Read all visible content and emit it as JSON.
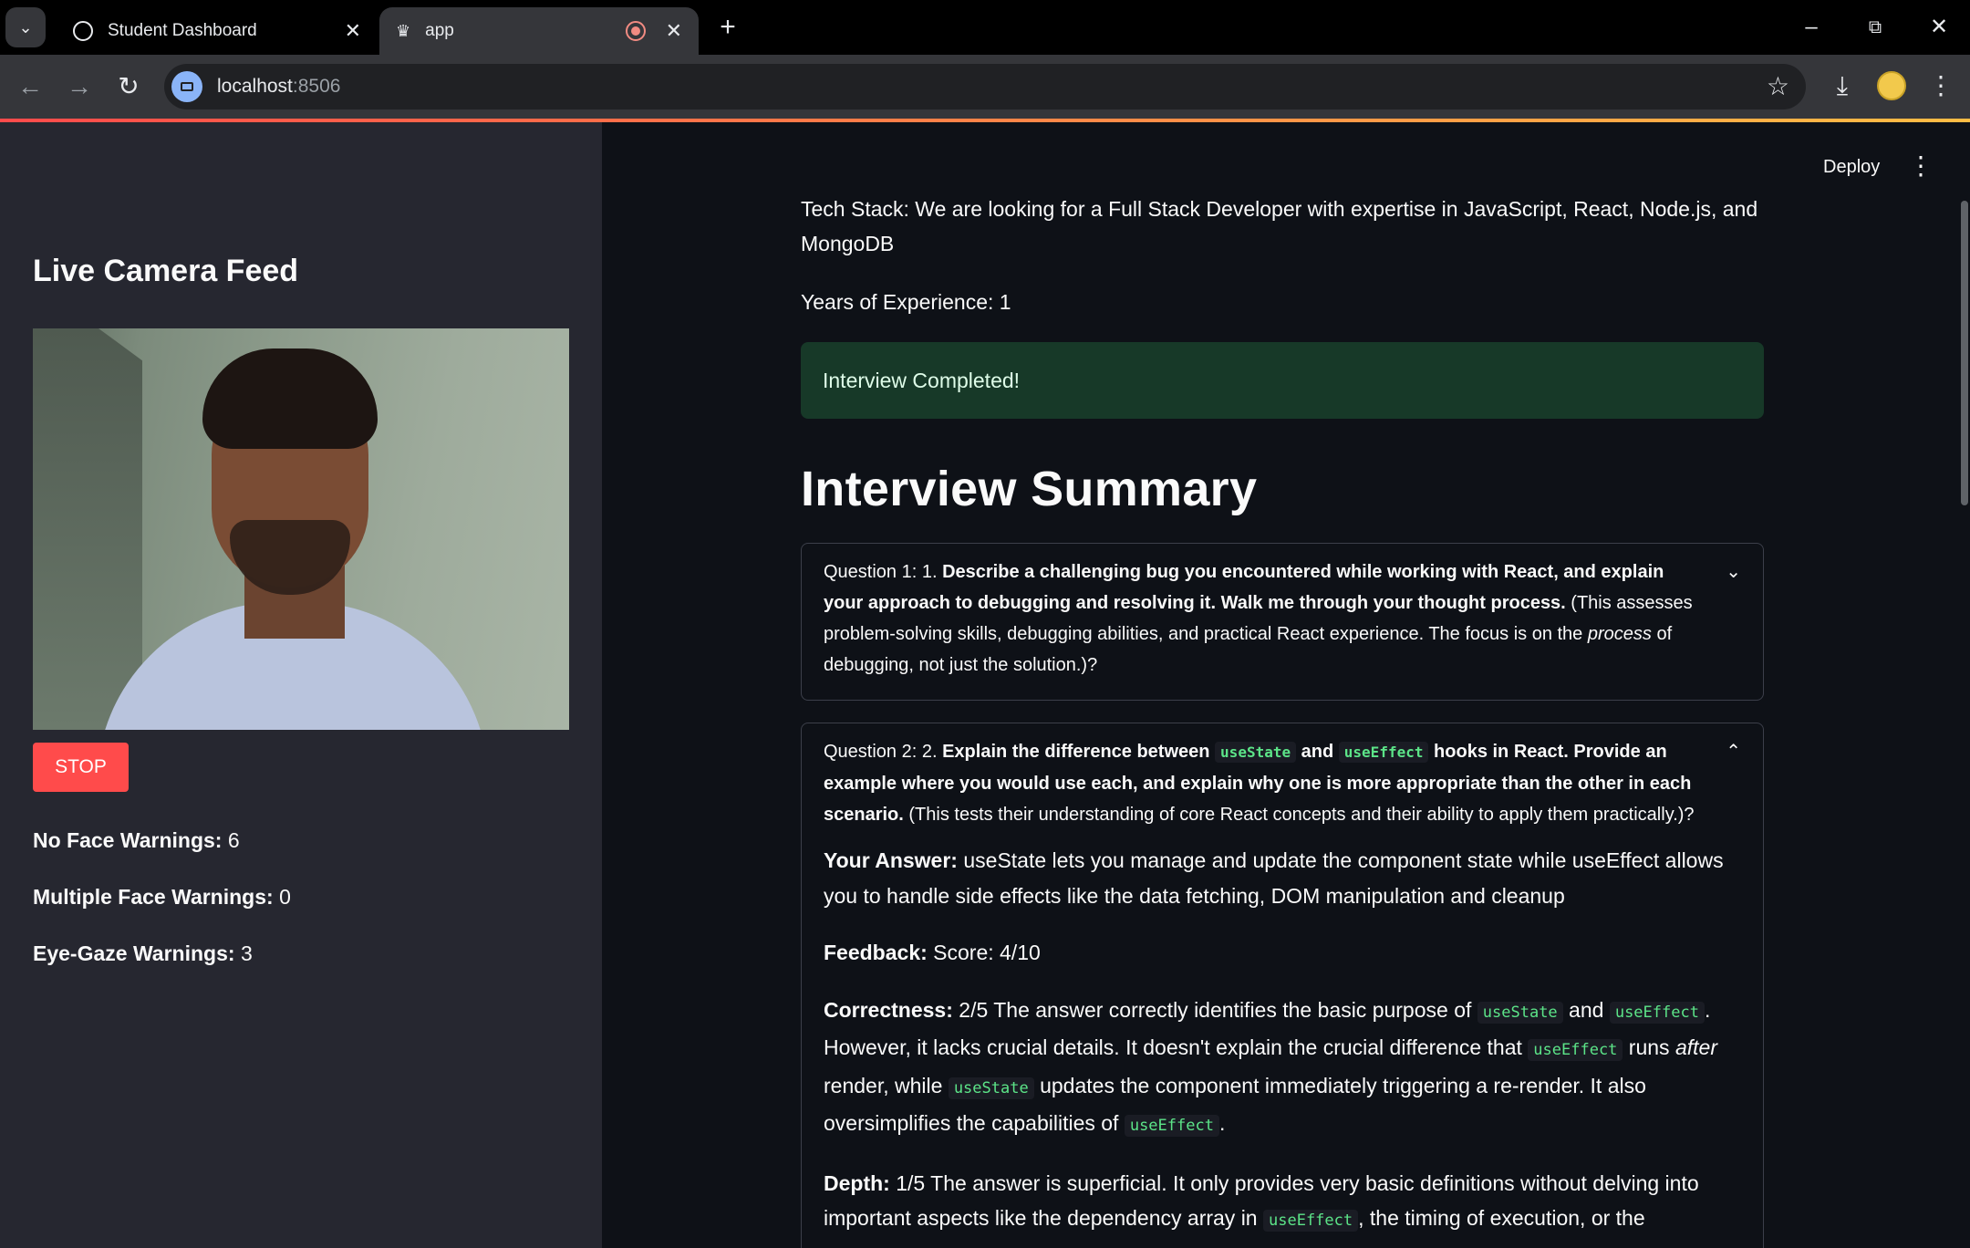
{
  "browser": {
    "tabs": [
      {
        "title": "Student Dashboard"
      },
      {
        "title": "app"
      }
    ],
    "url_host": "localhost",
    "url_port": ":8506"
  },
  "sidebar": {
    "title": "Live Camera Feed",
    "stop_label": "STOP",
    "warnings": [
      {
        "label": "No Face Warnings:",
        "value": "6"
      },
      {
        "label": "Multiple Face Warnings:",
        "value": "0"
      },
      {
        "label": "Eye-Gaze Warnings:",
        "value": "3"
      }
    ]
  },
  "header": {
    "deploy_label": "Deploy"
  },
  "main": {
    "tech_stack": "Tech Stack: We are looking for a Full Stack Developer with expertise in JavaScript, React, Node.js, and MongoDB",
    "experience": "Years of Experience: 1",
    "success_message": "Interview Completed!",
    "summary_title": "Interview Summary",
    "q1": {
      "prefix": "Question 1: 1. ",
      "bold": "Describe a challenging bug you encountered while working with React, and explain your approach to debugging and resolving it. Walk me through your thought process.",
      "rest_a": " (This assesses problem-solving skills, debugging abilities, and practical React experience. The focus is on the ",
      "italic": "process",
      "rest_b": " of debugging, not just the solution.)?"
    },
    "q2": {
      "prefix": "Question 2: 2. ",
      "bold_a": "Explain the difference between ",
      "code_a": "useState",
      "bold_b": " and ",
      "code_b": "useEffect",
      "bold_c": " hooks in React. Provide an example where you would use each, and explain why one is more appropriate than the other in each scenario.",
      "rest": " (This tests their understanding of core React concepts and their ability to apply them practically.)?",
      "answer_label": "Your Answer:",
      "answer": " useState lets you manage and update the component state while useEffect allows you to handle side effects like the data fetching, DOM manipulation and cleanup",
      "feedback_label": "Feedback:",
      "feedback": " Score: 4/10",
      "correctness_label": "Correctness:",
      "c1": " 2/5 The answer correctly identifies the basic purpose of ",
      "c_code1": "useState",
      "c2": " and ",
      "c_code2": "useEffect",
      "c3": ". However, it lacks crucial details. It doesn't explain the crucial difference that ",
      "c_code3": "useEffect",
      "c4": " runs ",
      "c_italic": "after",
      "c5": " render, while ",
      "c_code4": "useState",
      "c6": " updates the component immediately triggering a re-render. It also oversimplifies the capabilities of ",
      "c_code5": "useEffect",
      "c7": ".",
      "depth_label": "Depth:",
      "d1": " 1/5 The answer is superficial. It only provides very basic definitions without delving into important aspects like the dependency array in ",
      "d_code": "useEffect",
      "d2": ", the timing of execution, or the importance of cleanup functions. It lacks concrete examples to illustrate its points."
    }
  }
}
